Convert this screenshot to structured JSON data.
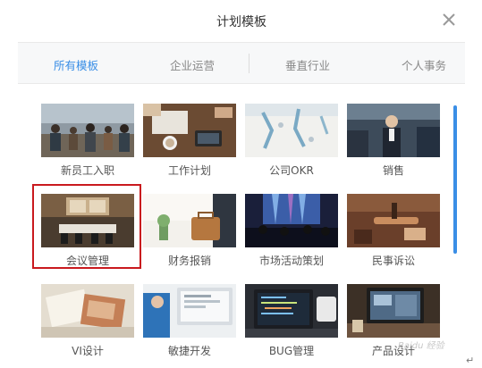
{
  "dialog": {
    "title": "计划模板",
    "close_icon": "close-icon"
  },
  "tabs": [
    {
      "label": "所有模板",
      "active": true
    },
    {
      "label": "企业运营",
      "active": false
    },
    {
      "label": "垂直行业",
      "active": false
    },
    {
      "label": "个人事务",
      "active": false
    }
  ],
  "templates": [
    {
      "label": "新员工入职",
      "selected": false
    },
    {
      "label": "工作计划",
      "selected": false
    },
    {
      "label": "公司OKR",
      "selected": false
    },
    {
      "label": "销售",
      "selected": false
    },
    {
      "label": "会议管理",
      "selected": true
    },
    {
      "label": "财务报销",
      "selected": false
    },
    {
      "label": "市场活动策划",
      "selected": false
    },
    {
      "label": "民事诉讼",
      "selected": false
    },
    {
      "label": "VI设计",
      "selected": false
    },
    {
      "label": "敏捷开发",
      "selected": false
    },
    {
      "label": "BUG管理",
      "selected": false
    },
    {
      "label": "产品设计",
      "selected": false
    }
  ],
  "colors": {
    "accent": "#3a8ee6",
    "selection_border": "#c9191e"
  },
  "watermark": "Baidu 经验",
  "return_mark": "↵"
}
